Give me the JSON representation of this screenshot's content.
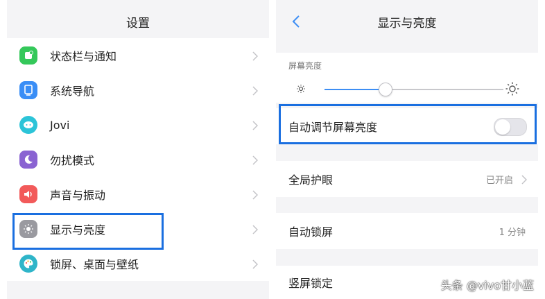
{
  "left": {
    "title": "设置",
    "items": [
      {
        "label": "状态栏与通知",
        "icon": "notification-icon",
        "color": "#34c85a"
      },
      {
        "label": "系统导航",
        "icon": "navigation-icon",
        "color": "#3a8ef6"
      },
      {
        "label": "Jovi",
        "icon": "jovi-icon",
        "color": "#2cc4d8"
      },
      {
        "label": "勿扰模式",
        "icon": "moon-icon",
        "color": "#8a63d2"
      },
      {
        "label": "声音与振动",
        "icon": "speaker-icon",
        "color": "#f25a5a"
      },
      {
        "label": "显示与亮度",
        "icon": "brightness-icon",
        "color": "#9a9aa0"
      },
      {
        "label": "锁屏、桌面与壁纸",
        "icon": "palette-icon",
        "color": "#2fb5c9"
      }
    ]
  },
  "right": {
    "title": "显示与亮度",
    "brightness_caption": "屏幕亮度",
    "brightness_level": 0.34,
    "auto_brightness": {
      "label": "自动调节屏幕亮度",
      "enabled": false
    },
    "rows": [
      {
        "label": "全局护眼",
        "value": "已开启"
      },
      {
        "label": "自动锁屏",
        "value": "1 分钟"
      },
      {
        "label": "竖屏锁定",
        "value": ""
      }
    ]
  },
  "watermark": "头条 @vivo甘小蓝",
  "colors": {
    "highlight": "#1a6fe0",
    "accent": "#3d8ef4",
    "background": "#f4f4f6"
  }
}
